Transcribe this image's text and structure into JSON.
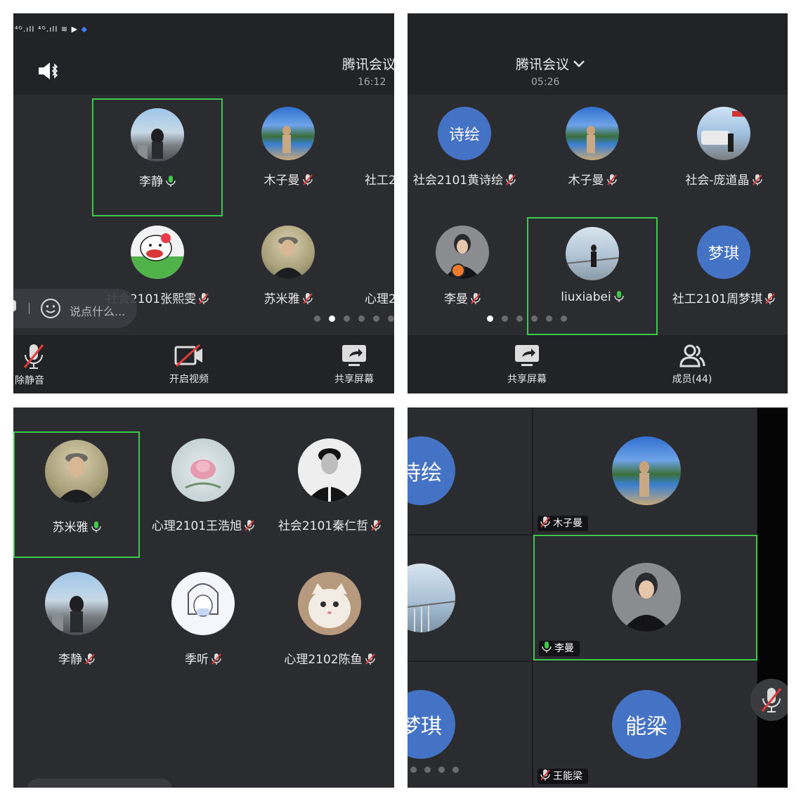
{
  "panel1": {
    "status_icons": "⁴ᴳ.ıll ⁴ᴳ.ıll ≋ ▶",
    "meeting_title": "腾讯会议",
    "time": "16:12",
    "participants": [
      {
        "name": "李静",
        "mic": "on"
      },
      {
        "name": "木子曼",
        "mic": "off"
      },
      {
        "name": "社工2",
        "mic": "none"
      },
      {
        "name": "社会2101张熙雯",
        "mic": "off"
      },
      {
        "name": "苏米雅",
        "mic": "off"
      },
      {
        "name": "心理2",
        "mic": "none"
      }
    ],
    "chat_placeholder": "说点什么...",
    "bottom": {
      "mute_label": "除静音",
      "video_label": "开启视频",
      "share_label": "共享屏幕"
    }
  },
  "panel2": {
    "meeting_title": "腾讯会议",
    "time": "05:26",
    "participants": [
      {
        "name": "社会2101黄诗绘",
        "avatar_text": "诗绘",
        "mic": "off"
      },
      {
        "name": "木子曼",
        "mic": "off"
      },
      {
        "name": "社会-庞道晶",
        "mic": "off"
      },
      {
        "name": "李曼",
        "mic": "off"
      },
      {
        "name": "liuxiabei",
        "mic": "on"
      },
      {
        "name": "社工2101周梦琪",
        "avatar_text": "梦琪",
        "mic": "off"
      }
    ],
    "bottom": {
      "share_label": "共享屏幕",
      "members_label": "成员(44)"
    }
  },
  "panel3": {
    "participants": [
      {
        "name": "苏米雅",
        "mic": "on"
      },
      {
        "name": "心理2101王浩旭",
        "mic": "off"
      },
      {
        "name": "社会2101秦仁哲",
        "mic": "off"
      },
      {
        "name": "李静",
        "mic": "off"
      },
      {
        "name": "季听",
        "mic": "off"
      },
      {
        "name": "心理2102陈鱼",
        "mic": "off"
      }
    ]
  },
  "panel4": {
    "cells": [
      {
        "avatar_text": "诗绘"
      },
      {
        "label": "木子曼",
        "mic": "off"
      },
      {
        "avatar_text": ""
      },
      {
        "label": "李曼",
        "mic": "on"
      },
      {
        "avatar_text": "梦琪"
      },
      {
        "label": "王能梁",
        "avatar_text": "能梁",
        "mic": "off"
      }
    ]
  },
  "colors": {
    "accent_blue": "#4472c4",
    "active_green": "#3ec94c",
    "bg": "#2b2c30",
    "bar": "#222326"
  }
}
